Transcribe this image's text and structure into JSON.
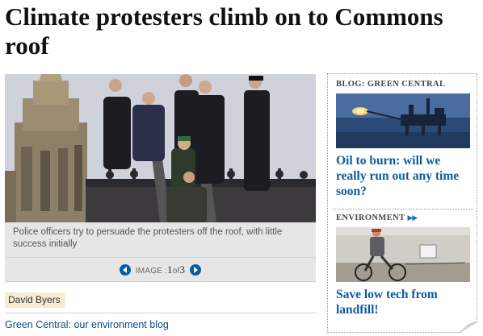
{
  "article": {
    "headline": "Climate protesters climb on to Commons roof",
    "image": {
      "caption": "Police officers try to persuade the protesters off the roof, with little success initially",
      "counter_prefix": "IMAGE :",
      "current": "1",
      "of_label": "of",
      "total": "3",
      "prev_icon": "chevron-left-icon",
      "next_icon": "chevron-right-icon"
    },
    "byline": "David Byers",
    "related_link": "Green Central: our environment blog"
  },
  "sidebar": {
    "items": [
      {
        "label": "BLOG: GREEN CENTRAL",
        "title": "Oil to burn: will we really run out any time soon?",
        "has_chevron": false
      },
      {
        "label": "ENVIRONMENT",
        "title": "Save low tech from landfill!",
        "has_chevron": true
      }
    ]
  },
  "colors": {
    "link": "#0c5c9c",
    "caption_bg": "#e6e6e6",
    "byline_bg": "#f5ecd1"
  }
}
